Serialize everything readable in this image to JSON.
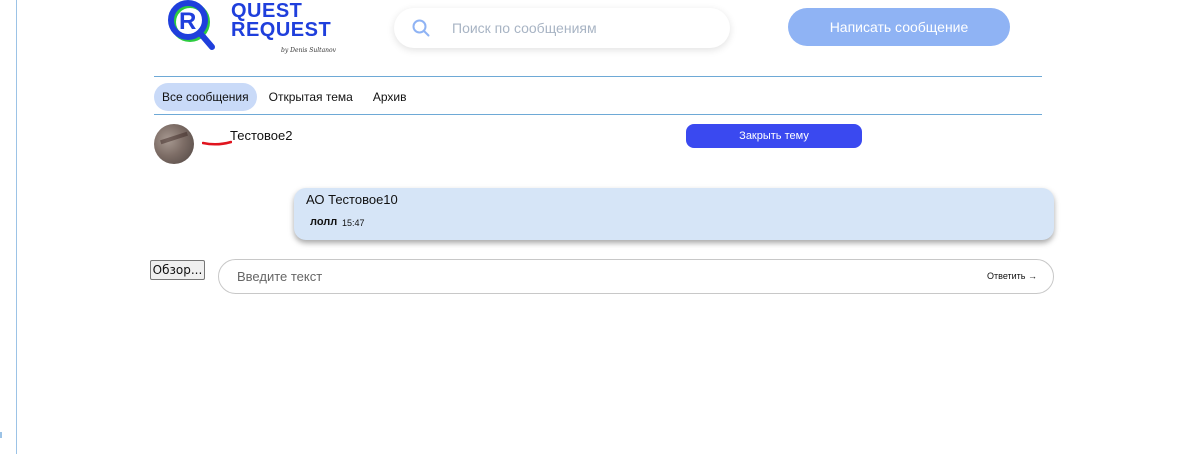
{
  "brand": {
    "line1": "QUEST",
    "line2": "REQUEST",
    "byline": "by Denis Sultanov"
  },
  "search": {
    "placeholder": "Поиск по сообщениям",
    "icon": "search-icon"
  },
  "header": {
    "compose_label": "Написать сообщение"
  },
  "tabs": [
    {
      "label": "Все сообщения",
      "active": true
    },
    {
      "label": "Открытая тема",
      "active": false
    },
    {
      "label": "Архив",
      "active": false
    }
  ],
  "topic": {
    "name": "Тестовое2",
    "close_label": "Закрыть тему"
  },
  "messages": [
    {
      "author": "АО Тестовое10",
      "text": "лолл",
      "time": "15:47"
    }
  ],
  "composer": {
    "browse_label": "Обзор...",
    "placeholder": "Введите текст",
    "reply_label": "Ответить →"
  },
  "colors": {
    "brand_blue": "#1f3fdc",
    "accent_green": "#2ecc40",
    "compose_button": "#8fb3f4",
    "close_button": "#3a49f0",
    "bubble": "#d6e5f7",
    "tab_active": "#c9daf8"
  }
}
